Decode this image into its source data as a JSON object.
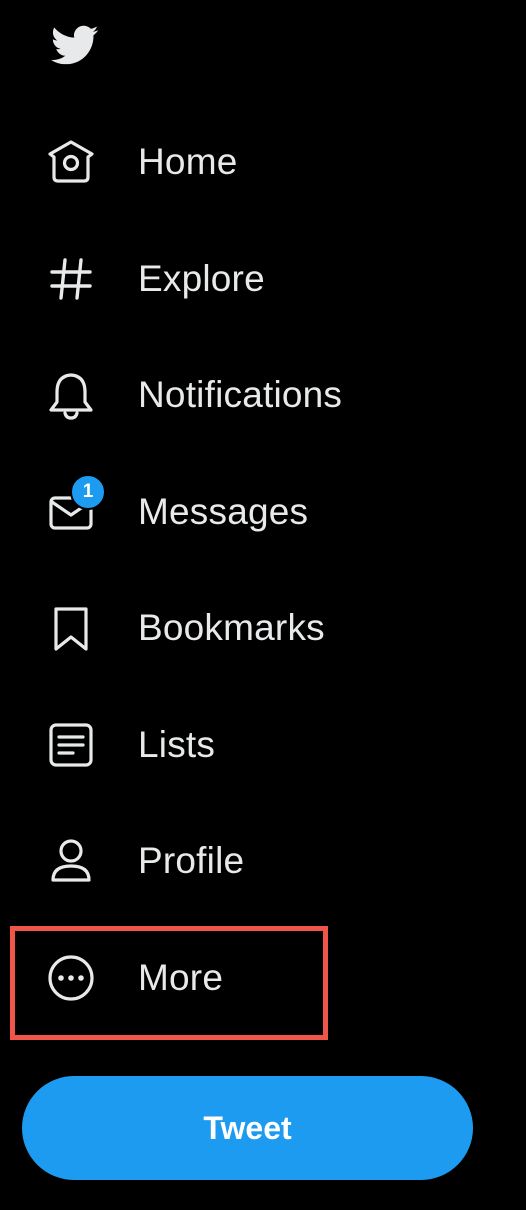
{
  "brand": {
    "logo_icon": "twitter-bird-icon",
    "logo_color": "#e7e9ea"
  },
  "nav": {
    "items": [
      {
        "id": "home",
        "label": "Home",
        "icon": "home-icon"
      },
      {
        "id": "explore",
        "label": "Explore",
        "icon": "hashtag-icon"
      },
      {
        "id": "notifications",
        "label": "Notifications",
        "icon": "bell-icon"
      },
      {
        "id": "messages",
        "label": "Messages",
        "icon": "envelope-icon",
        "badge": "1"
      },
      {
        "id": "bookmarks",
        "label": "Bookmarks",
        "icon": "bookmark-icon"
      },
      {
        "id": "lists",
        "label": "Lists",
        "icon": "list-icon"
      },
      {
        "id": "profile",
        "label": "Profile",
        "icon": "person-icon"
      },
      {
        "id": "more",
        "label": "More",
        "icon": "more-circle-icon",
        "highlighted": true
      }
    ]
  },
  "tweet_button": {
    "label": "Tweet"
  },
  "colors": {
    "background": "#000000",
    "text": "#e7e9ea",
    "accent": "#1d9bf0",
    "highlight_border": "#f0554a"
  }
}
